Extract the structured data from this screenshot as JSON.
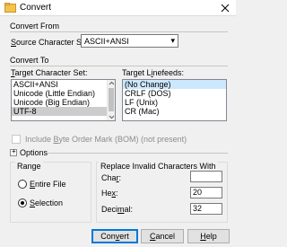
{
  "window": {
    "title": "Convert",
    "close_glyph": "✕",
    "icon": "app-icon"
  },
  "convert_from": {
    "heading": "Convert From",
    "source_label_prefix": "S",
    "source_label_rest": "ource Character Set:",
    "source_value": "ASCII+ANSI",
    "dropdown_glyph": "▾"
  },
  "convert_to": {
    "heading": "Convert To",
    "target_charset_label_prefix": "T",
    "target_charset_label_rest": "arget Character Set:",
    "charsets": [
      "ASCII+ANSI",
      "Unicode (Little Endian)",
      "Unicode (Big Endian)",
      "UTF-8"
    ],
    "selected_charset": "UTF-8",
    "target_linefeeds_label_prefix": "Target L",
    "target_linefeeds_label_u": "i",
    "target_linefeeds_label_rest": "nefeeds:",
    "linefeeds": [
      "(No Change)",
      "CRLF (DOS)",
      "LF (Unix)",
      "CR (Mac)"
    ],
    "selected_linefeed": "(No Change)"
  },
  "bom": {
    "label_prefix": "Include ",
    "label_u": "B",
    "label_rest": "yte Order Mark (BOM) (not present)",
    "checked": false,
    "enabled": false
  },
  "options": {
    "toggle_glyph": "+",
    "heading": "Options",
    "range": {
      "heading": "Range",
      "entire_file_u": "E",
      "entire_file_rest": "ntire File",
      "selection_u": "S",
      "selection_rest": "election",
      "selected": "selection"
    },
    "replace": {
      "heading": "Replace Invalid Characters With",
      "char_label_prefix": "Cha",
      "char_label_u": "r",
      "char_label_rest": ":",
      "char_value": "",
      "hex_label_prefix": "He",
      "hex_label_u": "x",
      "hex_label_rest": ":",
      "hex_value": "20",
      "decimal_label_prefix": "Deci",
      "decimal_label_u": "m",
      "decimal_label_rest": "al:",
      "decimal_value": "32"
    }
  },
  "buttons": {
    "convert_prefix": "Con",
    "convert_u": "v",
    "convert_rest": "ert",
    "cancel_u": "C",
    "cancel_rest": "ancel",
    "help_u": "H",
    "help_rest": "elp"
  }
}
